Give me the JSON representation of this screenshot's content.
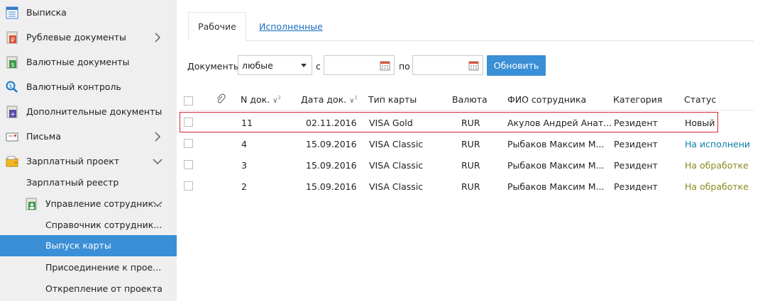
{
  "sidebar": {
    "items": [
      {
        "label": "Выписка",
        "icon": "statement-icon"
      },
      {
        "label": "Рублевые документы",
        "icon": "ruble-document-icon"
      },
      {
        "label": "Валютные документы",
        "icon": "dollar-document-icon"
      },
      {
        "label": "Валютный контроль",
        "icon": "magnifier-icon"
      },
      {
        "label": "Дополнительные документы",
        "icon": "add-document-icon"
      },
      {
        "label": "Письма",
        "icon": "letter-icon"
      },
      {
        "label": "Зарплатный проект",
        "icon": "wallet-icon"
      },
      {
        "label": "Зарплатный реестр"
      },
      {
        "label": "Управление сотрудник...",
        "icon": "employees-icon"
      },
      {
        "label": "Справочник сотрудник..."
      },
      {
        "label": "Выпуск карты"
      },
      {
        "label": "Присоединение к прое..."
      },
      {
        "label": "Открепление от проекта"
      }
    ]
  },
  "tabs": [
    {
      "label": "Рабочие"
    },
    {
      "label": "Исполненные"
    }
  ],
  "filter": {
    "documents_label": "Документы",
    "documents_value": "любые",
    "from_label": "с",
    "from_value": "",
    "to_label": "по",
    "to_value": "",
    "refresh_label": "Обновить"
  },
  "table": {
    "columns": [
      "N док.",
      "Дата док.",
      "Тип карты",
      "Валюта",
      "ФИО сотрудника",
      "Категория",
      "Статус"
    ],
    "sort_indices": {
      "doc": "2",
      "date": "1"
    },
    "rows": [
      {
        "num": "11",
        "date": "02.11.2016",
        "card": "VISA Gold",
        "currency": "RUR",
        "employee": "Акулов Андрей Анат...",
        "category": "Резидент",
        "status": "Новый",
        "status_kind": "new"
      },
      {
        "num": "4",
        "date": "15.09.2016",
        "card": "VISA Classic",
        "currency": "RUR",
        "employee": "Рыбаков Максим М...",
        "category": "Резидент",
        "status": "На исполнении",
        "status_kind": "exec"
      },
      {
        "num": "3",
        "date": "15.09.2016",
        "card": "VISA Classic",
        "currency": "RUR",
        "employee": "Рыбаков Максим М...",
        "category": "Резидент",
        "status": "На обработке",
        "status_kind": "proc"
      },
      {
        "num": "2",
        "date": "15.09.2016",
        "card": "VISA Classic",
        "currency": "RUR",
        "employee": "Рыбаков Максим М...",
        "category": "Резидент",
        "status": "На обработке",
        "status_kind": "proc"
      }
    ]
  },
  "colors": {
    "accent": "#3a8fd6",
    "sidebar_bg": "#efefef",
    "highlight_border": "#d7262e",
    "status_exec": "#0a7fa8",
    "status_proc": "#8a8a1f"
  }
}
